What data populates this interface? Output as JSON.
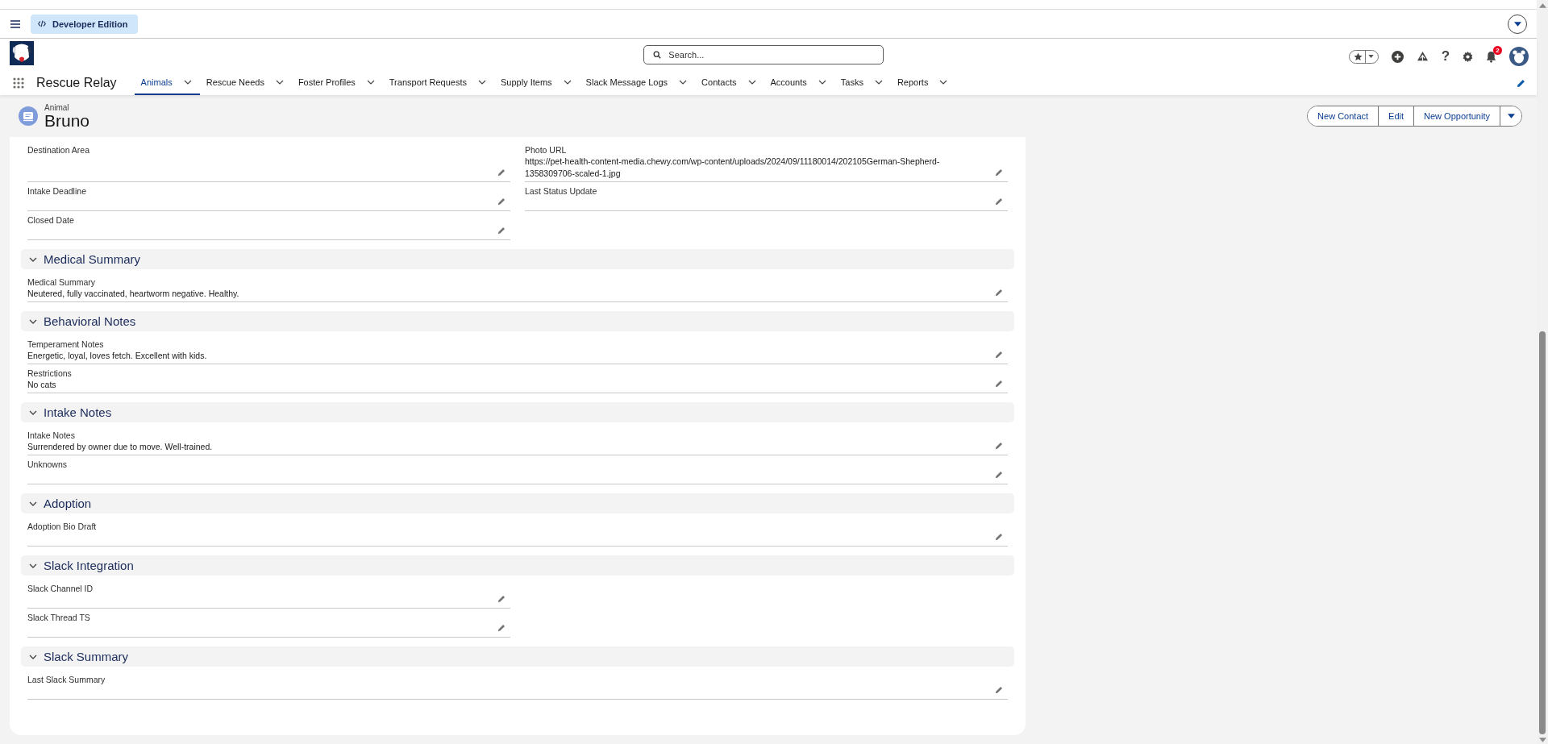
{
  "top_bar": {
    "badge": "Developer Edition"
  },
  "header": {
    "search": {
      "placeholder": "Search..."
    },
    "help": "?",
    "notification_count": "2"
  },
  "app_name": "Rescue Relay",
  "tabs": [
    {
      "label": "Animals",
      "selected": true
    },
    {
      "label": "Rescue Needs",
      "selected": false
    },
    {
      "label": "Foster Profiles",
      "selected": false
    },
    {
      "label": "Transport Requests",
      "selected": false
    },
    {
      "label": "Supply Items",
      "selected": false
    },
    {
      "label": "Slack Message Logs",
      "selected": false
    },
    {
      "label": "Contacts",
      "selected": false
    },
    {
      "label": "Accounts",
      "selected": false
    },
    {
      "label": "Tasks",
      "selected": false
    },
    {
      "label": "Reports",
      "selected": false
    }
  ],
  "record": {
    "object_type": "Animal",
    "name": "Bruno",
    "actions": [
      "New Contact",
      "Edit",
      "New Opportunity"
    ]
  },
  "sections": [
    {
      "fields": [
        {
          "label": "Destination Area",
          "kind": "half",
          "editable": true
        },
        {
          "label": "Photo URL",
          "value": "https://pet-health-content-media.chewy.com/wp-content/uploads/2024/09/11180014/202105German-Shepherd-1358309706-scaled-1.jpg",
          "kind": "half",
          "editable": true
        },
        {
          "label": "Intake Deadline",
          "kind": "half",
          "editable": true
        },
        {
          "label": "Last Status Update",
          "kind": "half",
          "editable": true
        },
        {
          "label": "Closed Date",
          "kind": "half",
          "editable": true
        }
      ]
    },
    {
      "title": "Medical Summary",
      "expanded": true,
      "fields": [
        {
          "label": "Medical Summary",
          "value": "Neutered, fully vaccinated, heartworm negative. Healthy.",
          "kind": "wide",
          "editable": true
        }
      ]
    },
    {
      "title": "Behavioral Notes",
      "expanded": true,
      "fields": [
        {
          "label": "Temperament Notes",
          "value": "Energetic, loyal, loves fetch. Excellent with kids.",
          "kind": "wide",
          "editable": true
        },
        {
          "label": "Restrictions",
          "value": "No cats",
          "kind": "wide",
          "editable": true
        }
      ]
    },
    {
      "title": "Intake Notes",
      "expanded": true,
      "fields": [
        {
          "label": "Intake Notes",
          "value": "Surrendered by owner due to move. Well-trained.",
          "kind": "wide",
          "editable": true
        },
        {
          "label": "Unknowns",
          "kind": "wide",
          "editable": true
        }
      ]
    },
    {
      "title": "Adoption",
      "expanded": true,
      "fields": [
        {
          "label": "Adoption Bio Draft",
          "kind": "wide",
          "editable": true
        }
      ]
    },
    {
      "title": "Slack Integration",
      "expanded": true,
      "fields": [
        {
          "label": "Slack Channel ID",
          "kind": "left",
          "editable": true
        },
        {
          "label": "Slack Thread TS",
          "kind": "left",
          "editable": true
        }
      ]
    },
    {
      "title": "Slack Summary",
      "expanded": true,
      "fields": [
        {
          "label": "Last Slack Summary",
          "kind": "wide",
          "editable": true
        }
      ]
    }
  ]
}
